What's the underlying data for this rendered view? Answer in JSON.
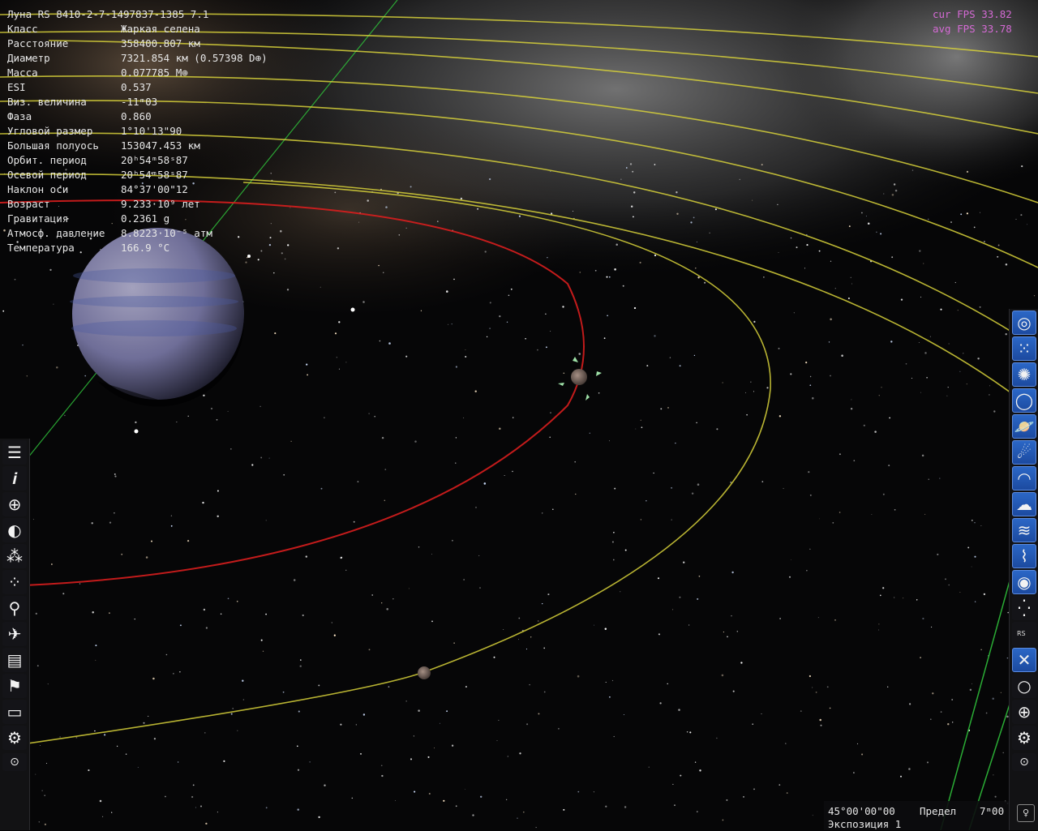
{
  "object": {
    "title": "Луна  RS 8410-2-7-1497837-1385 7.1",
    "properties": [
      {
        "label": "Класс",
        "value": "Жаркая селена"
      },
      {
        "label": "Расстояние",
        "value": "358400.807 км"
      },
      {
        "label": "Диаметр",
        "value": "7321.854 км (0.57398 D⊕)"
      },
      {
        "label": "Масса",
        "value": "0.077785 M⊕"
      },
      {
        "label": "ESI",
        "value": "0.537"
      },
      {
        "label": "Виз. величина",
        "value": "-11ᵐ03"
      },
      {
        "label": "Фаза",
        "value": "0.860"
      },
      {
        "label": "Угловой размер",
        "value": "1°10'13\"90"
      },
      {
        "label": "Большая полуось",
        "value": "153047.453 км"
      },
      {
        "label": "Орбит. период",
        "value": "20ʰ54ᵐ58ˢ87"
      },
      {
        "label": "Осевой период",
        "value": "20ʰ54ᵐ58ˢ87"
      },
      {
        "label": "Наклон оси",
        "value": "84°37'00\"12"
      },
      {
        "label": "Возраст",
        "value": "9.233·10⁹ лет"
      },
      {
        "label": "Гравитация",
        "value": "0.2361 g"
      },
      {
        "label": "Атмосф. давление",
        "value": "8.8223·10⁻⁵ атм"
      },
      {
        "label": "Температура",
        "value": "166.9 °C"
      }
    ]
  },
  "fps": {
    "current": "cur FPS 33.82",
    "average": "avg FPS 33.78"
  },
  "status": {
    "fov": "45°00'00\"00",
    "limit_label": "Предел",
    "limit_value": "7ᵐ00",
    "exposure": "Экспозиция 1"
  },
  "left_toolbar": [
    {
      "name": "menu-icon",
      "glyph": "☰"
    },
    {
      "name": "info-icon",
      "glyph": "𝒊"
    },
    {
      "name": "orbit-grid-icon",
      "glyph": "⊕"
    },
    {
      "name": "planet-system-icon",
      "glyph": "◐"
    },
    {
      "name": "star-browser-icon",
      "glyph": "⁂"
    },
    {
      "name": "star-field-icon",
      "glyph": "⁘"
    },
    {
      "name": "search-icon",
      "glyph": "⚲"
    },
    {
      "name": "spaceship-icon",
      "glyph": "✈"
    },
    {
      "name": "calendar-icon",
      "glyph": "▤"
    },
    {
      "name": "flag-icon",
      "glyph": "⚑"
    },
    {
      "name": "monitor-icon",
      "glyph": "▭"
    },
    {
      "name": "settings-gear-icon",
      "glyph": "⚙"
    },
    {
      "name": "small-options-icon",
      "glyph": "⊙"
    }
  ],
  "right_toolbar": [
    {
      "name": "galaxy-icon",
      "glyph": "◎",
      "style": "blue"
    },
    {
      "name": "star-cluster-icon",
      "glyph": "⁙",
      "style": "blue"
    },
    {
      "name": "globular-cluster-icon",
      "glyph": "✺",
      "style": "blue"
    },
    {
      "name": "nebula-ring-icon",
      "glyph": "◯",
      "style": "blue"
    },
    {
      "name": "planet-rings-icon",
      "glyph": "🪐",
      "style": "blue"
    },
    {
      "name": "comet-icon",
      "glyph": "☄",
      "style": "blue"
    },
    {
      "name": "asteroid-belt-icon",
      "glyph": "◠",
      "style": "blue"
    },
    {
      "name": "clouds-icon",
      "glyph": "☁",
      "style": "blue"
    },
    {
      "name": "water-waves-icon",
      "glyph": "≋",
      "style": "blue"
    },
    {
      "name": "aurora-icon",
      "glyph": "⌇",
      "style": "blue"
    },
    {
      "name": "accretion-disk-icon",
      "glyph": "◉",
      "style": "blue"
    },
    {
      "name": "stars-toggle-icon",
      "glyph": "⁛",
      "style": "dark"
    },
    {
      "name": "rs-labels-icon",
      "glyph": "RS",
      "style": "dark"
    },
    {
      "name": "directions-icon",
      "glyph": "✕",
      "style": "blue"
    },
    {
      "name": "circle-marker-icon",
      "glyph": "○",
      "style": "dark"
    },
    {
      "name": "globe-grid-icon",
      "glyph": "⊕",
      "style": "dark"
    },
    {
      "name": "right-settings-gear-icon",
      "glyph": "⚙",
      "style": "dark"
    },
    {
      "name": "right-small-options-icon",
      "glyph": "⊙",
      "style": "dark"
    }
  ],
  "colors": {
    "parent_orbits": "#d8d23a",
    "moon_orbit": "#d81e1e",
    "axis_line": "#2fbf3a",
    "fps_text": "#d46ad4",
    "button_blue": "#2b67c6"
  }
}
